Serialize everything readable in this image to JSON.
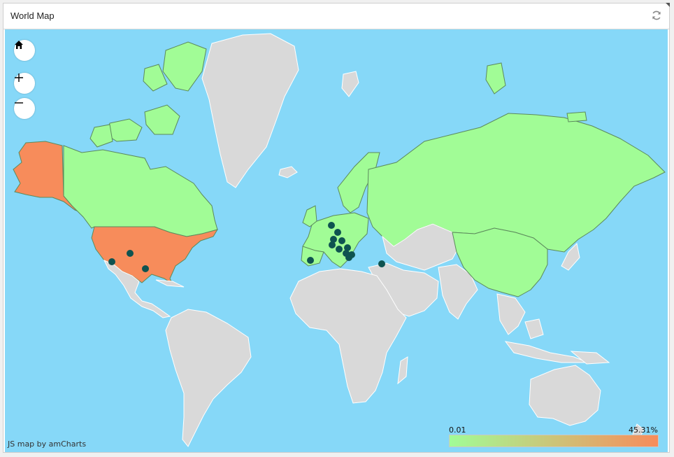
{
  "panel": {
    "title": "World Map"
  },
  "controls": {
    "home": "home-icon",
    "zoom_in": "plus-icon",
    "zoom_out": "minus-icon",
    "refresh": "refresh-icon"
  },
  "map": {
    "credit": "JS map by amCharts",
    "legend": {
      "min_label": "0.01",
      "max_label": "45.31%",
      "min_color": "#a1fc96",
      "max_color": "#f78c5b"
    },
    "colors": {
      "water": "#86d8f8",
      "land": "#d9d9d9",
      "border": "#ffffff",
      "region_border": "#5c8a5c",
      "marker": "#0f5350"
    },
    "highlighted_regions": [
      {
        "region": "United States",
        "color": "#f78c5b"
      },
      {
        "region": "Alaska",
        "color": "#f78c5b"
      },
      {
        "region": "Canada",
        "color": "#a1fc96"
      },
      {
        "region": "Greenland",
        "color": "#d9d9d9"
      },
      {
        "region": "Russia",
        "color": "#a1fc96"
      },
      {
        "region": "China",
        "color": "#a1fc96"
      },
      {
        "region": "Western Europe",
        "color": "#a1fc96"
      }
    ],
    "markers_count_note": ""
  }
}
